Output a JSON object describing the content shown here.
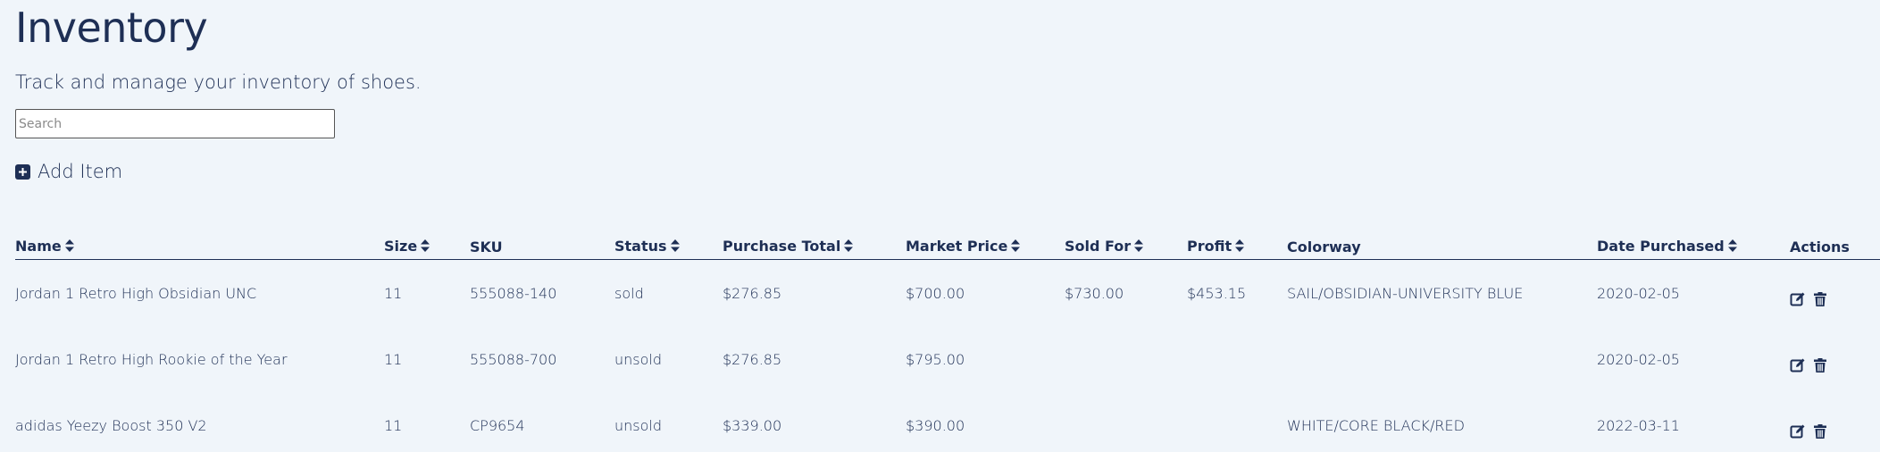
{
  "page": {
    "title": "Inventory",
    "subtitle": "Track and manage your inventory of shoes."
  },
  "search": {
    "placeholder": "Search",
    "value": ""
  },
  "add_item": {
    "label": "Add Item",
    "icon": "plus-square-icon"
  },
  "table": {
    "columns": [
      {
        "label": "Name",
        "sortable": true
      },
      {
        "label": "Size",
        "sortable": true
      },
      {
        "label": "SKU",
        "sortable": false
      },
      {
        "label": "Status",
        "sortable": true
      },
      {
        "label": "Purchase Total",
        "sortable": true
      },
      {
        "label": "Market Price",
        "sortable": true
      },
      {
        "label": "Sold For",
        "sortable": true
      },
      {
        "label": "Profit",
        "sortable": true
      },
      {
        "label": "Colorway",
        "sortable": false
      },
      {
        "label": "Date Purchased",
        "sortable": true
      },
      {
        "label": "Actions",
        "sortable": false
      }
    ],
    "rows": [
      {
        "name": "Jordan 1 Retro High Obsidian UNC",
        "size": "11",
        "sku": "555088-140",
        "status": "sold",
        "purchase_total": "$276.85",
        "market_price": "$700.00",
        "sold_for": "$730.00",
        "profit": "$453.15",
        "colorway": "SAIL/OBSIDIAN-UNIVERSITY BLUE",
        "date_purchased": "2020-02-05"
      },
      {
        "name": "Jordan 1 Retro High Rookie of the Year",
        "size": "11",
        "sku": "555088-700",
        "status": "unsold",
        "purchase_total": "$276.85",
        "market_price": "$795.00",
        "sold_for": "",
        "profit": "",
        "colorway": "",
        "date_purchased": "2020-02-05"
      },
      {
        "name": "adidas Yeezy Boost 350 V2",
        "size": "11",
        "sku": "CP9654",
        "status": "unsold",
        "purchase_total": "$339.00",
        "market_price": "$390.00",
        "sold_for": "",
        "profit": "",
        "colorway": "WHITE/CORE BLACK/RED",
        "date_purchased": "2022-03-11"
      }
    ],
    "row_action_icons": [
      "edit-icon",
      "trash-icon"
    ]
  },
  "colors": {
    "text": "#1e2f55",
    "background": "#f0f5fa"
  }
}
